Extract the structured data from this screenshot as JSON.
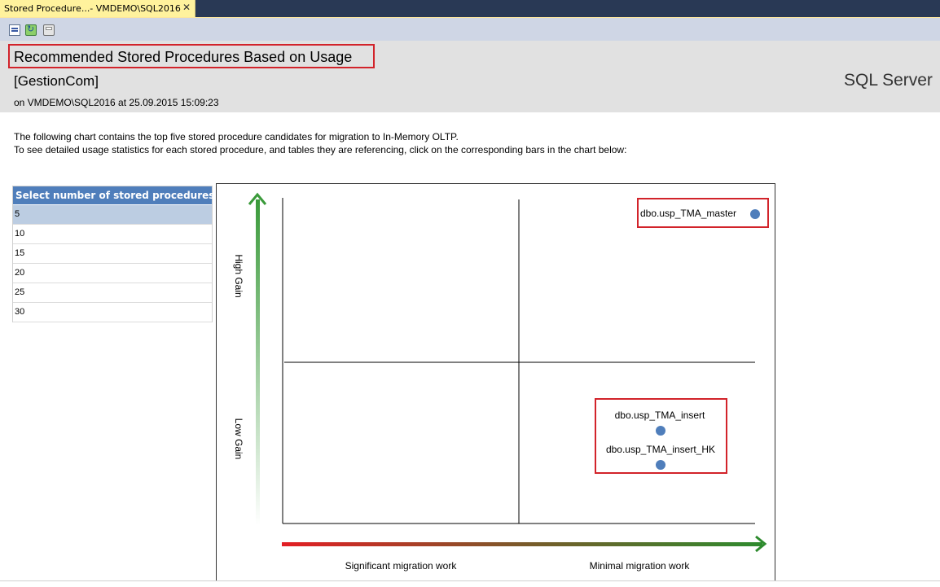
{
  "tab": {
    "title": "Stored Procedure...- VMDEMO\\SQL2016",
    "close_icon": "close-icon"
  },
  "toolbar": {
    "icons": [
      "document-map-icon",
      "refresh-icon",
      "print-icon"
    ]
  },
  "report": {
    "title": "Recommended Stored Procedures Based on Usage",
    "database": "[GestionCom]",
    "server_line": "on VMDEMO\\SQL2016 at 25.09.2015 15:09:23",
    "product": "SQL Server",
    "description_line1": "The following chart contains the top five stored procedure candidates for migration to In-Memory OLTP.",
    "description_line2": "To see detailed usage statistics for each stored procedure, and tables they are referencing, click on the corresponding bars in the chart below:"
  },
  "selector": {
    "title": "Select number of stored procedures:",
    "options": [
      "5",
      "10",
      "15",
      "20",
      "25",
      "30"
    ],
    "selected": "5"
  },
  "colors": {
    "highlight_border": "#D2232A",
    "marker": "#4F7EBB",
    "selector_header": "#4F7EBB",
    "arrow_green": "#2E8B2E",
    "arrow_red": "#E31E24"
  },
  "chart": {
    "y_labels": {
      "high": "High Gain",
      "low": "Low Gain"
    },
    "x_labels": {
      "left": "Significant migration work",
      "right": "Minimal migration work"
    },
    "points": [
      {
        "label": "dbo.usp_TMA_master",
        "quadrant": "high-gain / minimal-work"
      },
      {
        "label": "dbo.usp_TMA_insert",
        "quadrant": "low-gain / minimal-work"
      },
      {
        "label": "dbo.usp_TMA_insert_HK",
        "quadrant": "low-gain / minimal-work"
      }
    ]
  }
}
